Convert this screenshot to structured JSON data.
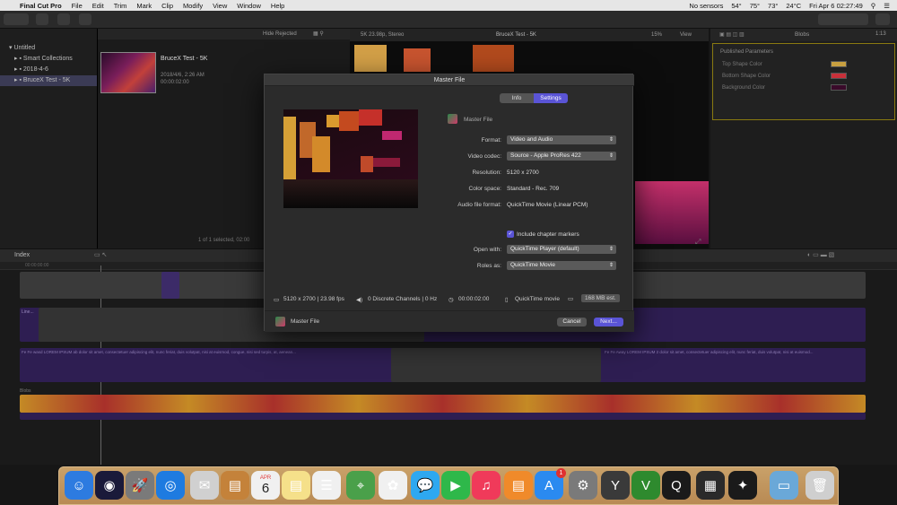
{
  "menubar": {
    "apple_icon": "apple-logo",
    "items": [
      "Final Cut Pro",
      "File",
      "Edit",
      "Trim",
      "Mark",
      "Clip",
      "Modify",
      "View",
      "Window",
      "Help"
    ],
    "status": {
      "sensors": "No sensors",
      "temp1": "54°",
      "temp2": "75°",
      "temp3": "73°",
      "weather": "24°C",
      "datetime": "Fri Apr 6  02:27:49"
    }
  },
  "library": {
    "items": [
      "Untitled",
      "Smart Collections",
      "2018-4-6",
      "BruceX Test - 5K"
    ],
    "selected": 3
  },
  "browser": {
    "filter": "Hide Rejected",
    "clip_name": "BruceX Test - 5K",
    "clip_date": "2018/4/6, 2:26 AM",
    "clip_time": "00:00:02:00",
    "selection_status": "1 of 1 selected, 02:00",
    "format_info": "5K 23.98p, Stereo"
  },
  "viewer": {
    "title": "BruceX Test - 5K",
    "zoom": "15%",
    "view_label": "View"
  },
  "inspector": {
    "title": "Blobs",
    "timecode": "1:13",
    "section": "Published Parameters",
    "params": [
      {
        "label": "Top Shape Color",
        "color": "#c8a040"
      },
      {
        "label": "Bottom Shape Color",
        "color": "#c8303a"
      },
      {
        "label": "Background Color",
        "color": "#3a0a2a"
      }
    ]
  },
  "timeline": {
    "index_label": "Index",
    "clip_label_1": "Line...",
    "lorem_text_1": "Fe Fe wasd LOREM IPSUM ab dolor sit amet, consectetuer adipiscing elit, nunc feriat, duis volutpat, nisi at euismod, congue, nisi sed turpis, at, aenean...",
    "lorem_text_2": "Fe Fe Away LOREM IPSUM 2 dolor sit amet, consectetuer adipiscing elit, nunc feriat, duis volutpat, nisi at euismod...",
    "blobs_label": "Blobs",
    "timecode_start": "00:00:00:00"
  },
  "dialog": {
    "title": "Master File",
    "tabs": [
      "Info",
      "Settings"
    ],
    "active_tab": 1,
    "preset_name": "Master File",
    "fields": {
      "format_label": "Format:",
      "format_value": "Video and Audio",
      "codec_label": "Video codec:",
      "codec_value": "Source - Apple ProRes 422",
      "resolution_label": "Resolution:",
      "resolution_value": "5120 x 2700",
      "colorspace_label": "Color space:",
      "colorspace_value": "Standard - Rec. 709",
      "audio_label": "Audio file format:",
      "audio_value": "QuickTime Movie (Linear PCM)",
      "chapter_label": "Include chapter markers",
      "chapter_checked": true,
      "openwith_label": "Open with:",
      "openwith_value": "QuickTime Player (default)",
      "roles_label": "Roles as:",
      "roles_value": "QuickTime Movie"
    },
    "infobar": {
      "video": "5120 x 2700 | 23.98 fps",
      "audio": "0 Discrete Channels | 0 Hz",
      "duration": "00:00:02:00",
      "file": "QuickTime movie",
      "size": "168 MB est."
    },
    "footer_name": "Master File",
    "cancel": "Cancel",
    "next": "Next..."
  },
  "dock": {
    "apps": [
      "finder-icon",
      "siri-icon",
      "launchpad-icon",
      "safari-icon",
      "mail-icon",
      "contacts-icon",
      "calendar-icon",
      "notes-icon",
      "reminders-icon",
      "maps-icon",
      "photos-icon",
      "messages-icon",
      "facetime-icon",
      "music-icon",
      "books-icon",
      "app-store-icon",
      "system-preferences-icon",
      "final-cut-icon-2",
      "vibrant-icon",
      "qq-icon",
      "activity-monitor-icon",
      "final-cut-pro-icon",
      "downloads-folder-icon",
      "trash-icon"
    ],
    "calendar_day": "6",
    "calendar_month": "APR",
    "app_store_badge": "1"
  }
}
